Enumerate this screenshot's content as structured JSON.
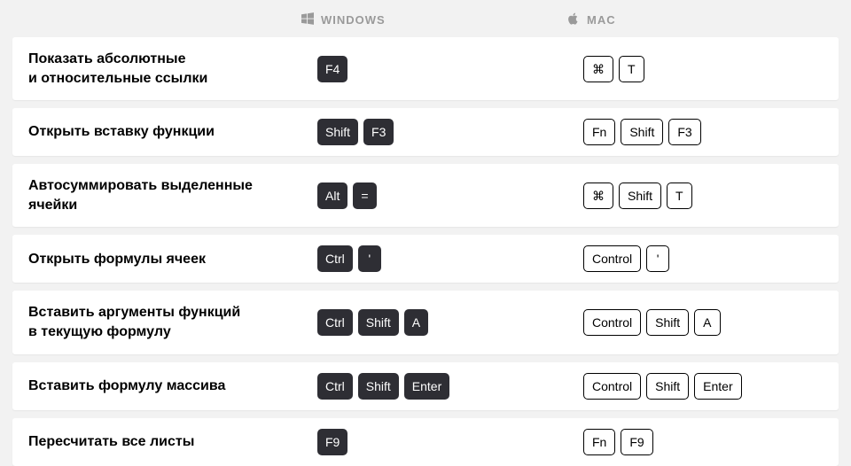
{
  "header": {
    "windows_label": "WINDOWS",
    "mac_label": "MAC"
  },
  "rows": [
    {
      "desc_line1": "Показать абсолютные",
      "desc_line2": "и относительные ссылки",
      "win_keys": [
        "F4"
      ],
      "mac_keys": [
        "⌘",
        "T"
      ]
    },
    {
      "desc_line1": "Открыть вставку функции",
      "desc_line2": "",
      "win_keys": [
        "Shift",
        "F3"
      ],
      "mac_keys": [
        "Fn",
        "Shift",
        "F3"
      ]
    },
    {
      "desc_line1": "Автосуммировать выделенные",
      "desc_line2": "ячейки",
      "win_keys": [
        "Alt",
        "="
      ],
      "mac_keys": [
        "⌘",
        "Shift",
        "T"
      ]
    },
    {
      "desc_line1": "Открыть формулы ячеек",
      "desc_line2": "",
      "win_keys": [
        "Ctrl",
        "'"
      ],
      "mac_keys": [
        "Control",
        "'"
      ]
    },
    {
      "desc_line1": "Вставить аргументы функций",
      "desc_line2": "в текущую формулу",
      "win_keys": [
        "Ctrl",
        "Shift",
        "A"
      ],
      "mac_keys": [
        "Control",
        "Shift",
        "A"
      ]
    },
    {
      "desc_line1": "Вставить формулу массива",
      "desc_line2": "",
      "win_keys": [
        "Ctrl",
        "Shift",
        "Enter"
      ],
      "mac_keys": [
        "Control",
        "Shift",
        "Enter"
      ]
    },
    {
      "desc_line1": "Пересчитать все листы",
      "desc_line2": "",
      "win_keys": [
        "F9"
      ],
      "mac_keys": [
        "Fn",
        "F9"
      ]
    }
  ]
}
